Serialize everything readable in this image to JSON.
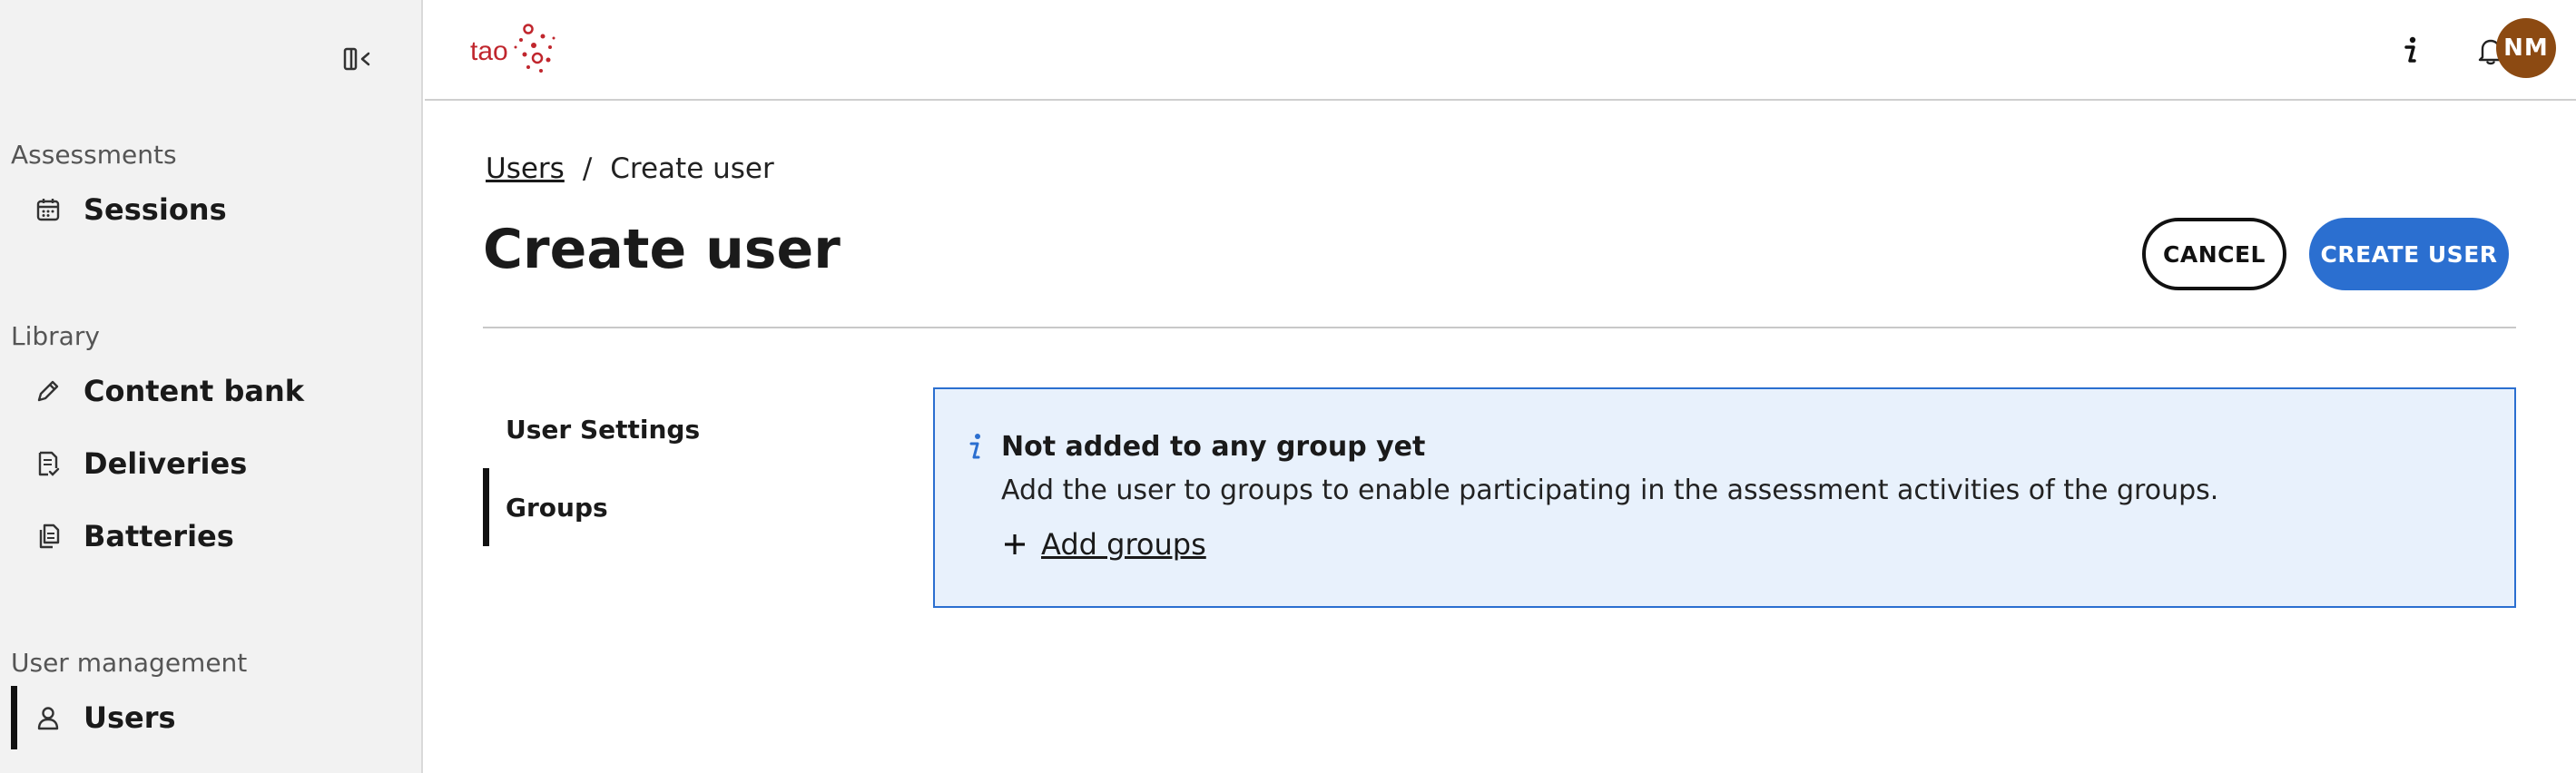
{
  "app": {
    "logo_text": "tao"
  },
  "sidebar": {
    "collapse_icon": "sidebar-collapse-icon",
    "sections": [
      {
        "label": "Assessments",
        "items": [
          {
            "label": "Sessions",
            "icon": "calendar-icon"
          }
        ]
      },
      {
        "label": "Library",
        "items": [
          {
            "label": "Content bank",
            "icon": "pencil-icon"
          },
          {
            "label": "Deliveries",
            "icon": "document-check-icon"
          },
          {
            "label": "Batteries",
            "icon": "documents-icon"
          }
        ]
      },
      {
        "label": "User management",
        "items": [
          {
            "label": "Users",
            "icon": "user-icon",
            "active": true
          }
        ]
      }
    ]
  },
  "header": {
    "info_icon": "info-icon",
    "notifications_icon": "bell-icon",
    "avatar_initials": "NM",
    "avatar_color": "#8c4a12"
  },
  "breadcrumb": {
    "parent": "Users",
    "separator": "/",
    "current": "Create user"
  },
  "page": {
    "title": "Create user",
    "cancel_label": "CANCEL",
    "create_label": "CREATE USER"
  },
  "tabs": [
    {
      "label": "User Settings",
      "active": false
    },
    {
      "label": "Groups",
      "active": true
    }
  ],
  "notice": {
    "title": "Not added to any group yet",
    "text": "Add the user to groups to enable participating in the assessment activities of the groups.",
    "action_label": "Add groups"
  },
  "colors": {
    "accent": "#2b6fd0",
    "notice_bg": "#e8f1fc",
    "sidebar_bg": "#f2f2f2",
    "logo_red": "#c0262d"
  }
}
